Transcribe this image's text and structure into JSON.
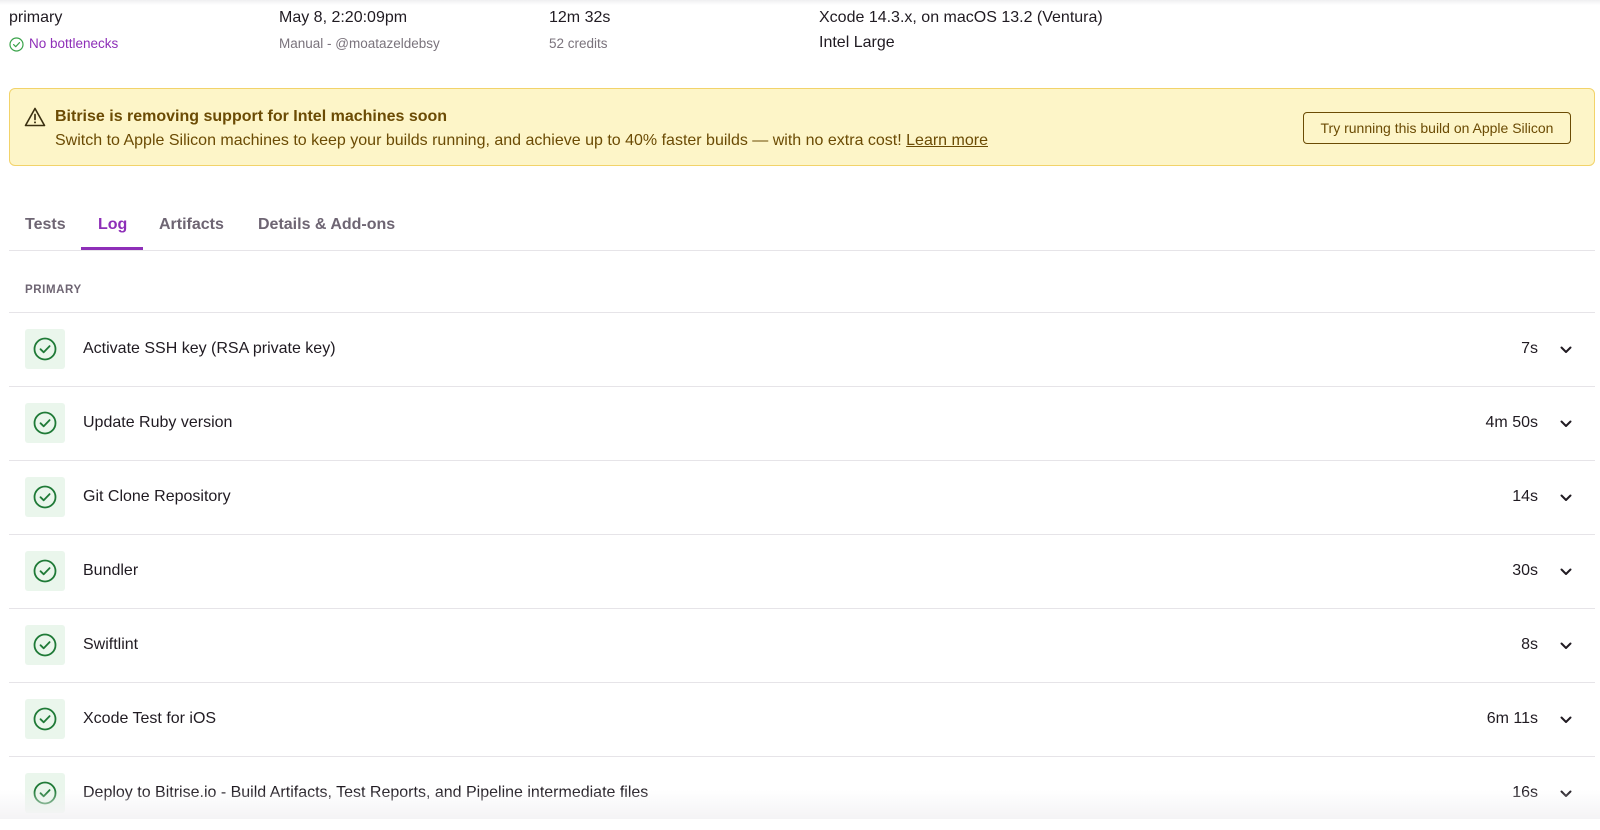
{
  "build_meta": {
    "workflow": "primary",
    "bottleneck_status": "No bottlenecks",
    "started_at": "May 8, 2:20:09pm",
    "trigger": "Manual - @moatazeldebsy",
    "duration": "12m 32s",
    "credits": "52 credits",
    "stack": "Xcode 14.3.x, on macOS 13.2 (Ventura)",
    "machine": "Intel Large",
    "status_color": "#3aa34a"
  },
  "banner": {
    "icon": "warning-triangle-icon",
    "title": "Bitrise is removing support for Intel machines soon",
    "text": "Switch to Apple Silicon machines to keep your builds running, and achieve up to 40% faster builds — with no extra cost!",
    "link_label": "Learn more",
    "button_label": "Try running this build on Apple Silicon",
    "background": "#fdf5c8",
    "text_color": "#6b4b04"
  },
  "tabs": [
    {
      "label": "Tests",
      "active": false
    },
    {
      "label": "Log",
      "active": true
    },
    {
      "label": "Artifacts",
      "active": false
    },
    {
      "label": "Details & Add-ons",
      "active": false
    }
  ],
  "accent_color": "#8e2fb8",
  "log": {
    "section_label": "PRIMARY",
    "steps": [
      {
        "name": "Activate SSH key (RSA private key)",
        "duration": "7s",
        "status": "success"
      },
      {
        "name": "Update Ruby version",
        "duration": "4m 50s",
        "status": "success"
      },
      {
        "name": "Git Clone Repository",
        "duration": "14s",
        "status": "success"
      },
      {
        "name": "Bundler",
        "duration": "30s",
        "status": "success"
      },
      {
        "name": "Swiftlint",
        "duration": "8s",
        "status": "success"
      },
      {
        "name": "Xcode Test for iOS",
        "duration": "6m 11s",
        "status": "success"
      },
      {
        "name": "Deploy to Bitrise.io - Build Artifacts, Test Reports, and Pipeline intermediate files",
        "duration": "16s",
        "status": "success"
      }
    ]
  }
}
